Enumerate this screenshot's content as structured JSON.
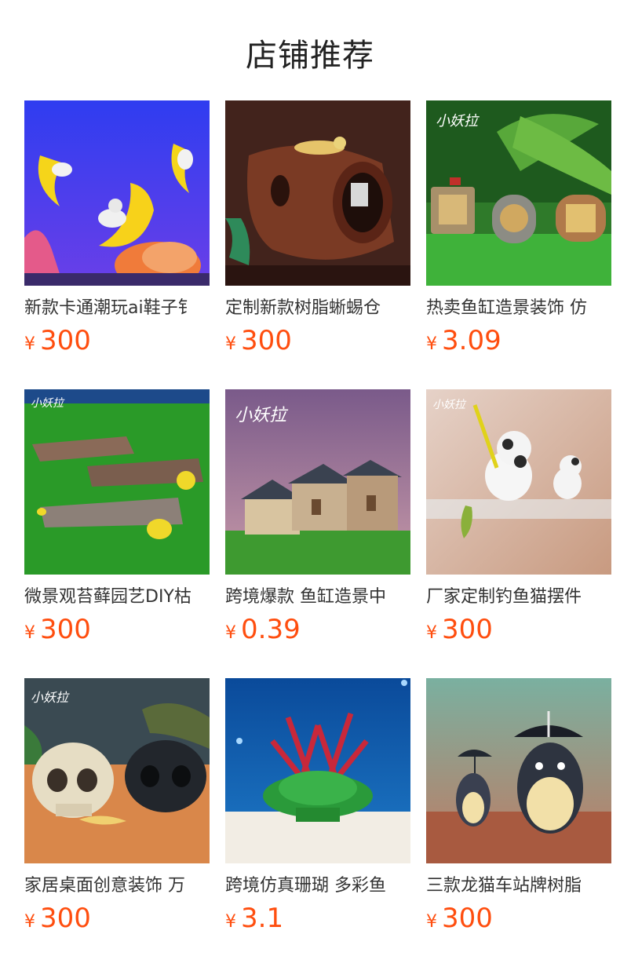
{
  "page": {
    "title": "店铺推荐"
  },
  "colors": {
    "price": "#ff4e0f",
    "title": "#333333",
    "heading": "#222222"
  },
  "products": [
    {
      "title": "新款卡通潮玩ai鞋子钅",
      "currency": "¥",
      "price": "300",
      "image": "moon-bear-ornament-image"
    },
    {
      "title": "定制新款树脂蜥蜴仓",
      "currency": "¥",
      "price": "300",
      "image": "resin-log-hideout-image"
    },
    {
      "title": "热卖鱼缸造景装饰 仿",
      "currency": "¥",
      "price": "3.09",
      "image": "fairy-window-ornament-image"
    },
    {
      "title": "微景观苔藓园艺DIY枯",
      "currency": "¥",
      "price": "300",
      "image": "resin-branch-image"
    },
    {
      "title": "跨境爆款 鱼缸造景中",
      "currency": "¥",
      "price": "0.39",
      "image": "chinese-house-ornament-image"
    },
    {
      "title": "厂家定制钓鱼猫摆件",
      "currency": "¥",
      "price": "300",
      "image": "fishing-cat-ornament-image"
    },
    {
      "title": "家居桌面创意装饰 万",
      "currency": "¥",
      "price": "300",
      "image": "resin-skull-image"
    },
    {
      "title": "跨境仿真珊瑚 多彩鱼",
      "currency": "¥",
      "price": "3.1",
      "image": "artificial-coral-image"
    },
    {
      "title": "三款龙猫车站牌树脂",
      "currency": "¥",
      "price": "300",
      "image": "totoro-figure-image"
    }
  ]
}
